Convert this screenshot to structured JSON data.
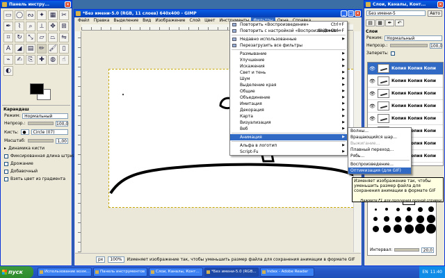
{
  "toolbox": {
    "title": "Панель инстру...",
    "tool_options_title": "Карандаш",
    "mode_label": "Режим:",
    "mode_value": "Нормальный",
    "opacity_label": "Непрозр.:",
    "opacity_value": "100,0",
    "brush_label": "Кисть:",
    "brush_value": "Circle (07)",
    "scale_label": "Масштаб:",
    "scale_value": "1,00",
    "dynamics_label": "Динамика кисти",
    "fade_label": "Фиксированная длина штриха",
    "jitter_label": "Дрожание",
    "incremental_label": "Добавочный",
    "gradient_label": "Взять цвет из градиента"
  },
  "image_window": {
    "title": "*Без имени-5.0 (RGB, 11 слоев) 640x400 - GIMP",
    "menu": [
      "Файл",
      "Правка",
      "Выделение",
      "Вид",
      "Изображение",
      "Слой",
      "Цвет",
      "Инструменты",
      "Фильтры",
      "Окна",
      "Справка"
    ],
    "status": {
      "unit": "px",
      "zoom": "100%",
      "message": "Изменяет изображение так, чтобы уменьшить размер файла для сохранения анимации в формате GIF"
    }
  },
  "filters_menu": {
    "items": [
      {
        "label": "Повторить «Воспроизведение»",
        "shortcut": "Ctrl+F"
      },
      {
        "label": "Повторить с настройкой «Воспроизведение»",
        "shortcut": "Shift+Ctrl+F"
      },
      {
        "label": "Недавно использованные",
        "shortcut": ""
      },
      {
        "label": "Перезагрузить все фильтры",
        "shortcut": ""
      },
      {
        "label": "Размывание",
        "shortcut": ""
      },
      {
        "label": "Улучшение",
        "shortcut": ""
      },
      {
        "label": "Искажения",
        "shortcut": ""
      },
      {
        "label": "Свет и тень",
        "shortcut": ""
      },
      {
        "label": "Шум",
        "shortcut": ""
      },
      {
        "label": "Выделение края",
        "shortcut": ""
      },
      {
        "label": "Общие",
        "shortcut": ""
      },
      {
        "label": "Объединение",
        "shortcut": ""
      },
      {
        "label": "Имитация",
        "shortcut": ""
      },
      {
        "label": "Декорация",
        "shortcut": ""
      },
      {
        "label": "Карта",
        "shortcut": ""
      },
      {
        "label": "Визуализация",
        "shortcut": ""
      },
      {
        "label": "Веб",
        "shortcut": ""
      },
      {
        "label": "Анимация",
        "shortcut": ""
      },
      {
        "label": "Альфа в логотип",
        "shortcut": ""
      },
      {
        "label": "Script-Fu",
        "shortcut": ""
      }
    ]
  },
  "animation_menu": {
    "items": [
      "Волны...",
      "Вращающийся шар...",
      "Выжигание...",
      "Плавный переход...",
      "Рябь...",
      "Воспроизведение...",
      "Оптимизация (для GIF)"
    ]
  },
  "tooltip": {
    "text": "Изменяет изображение так, чтобы уменьшить размер файла для сохранения анимации в формате GIF",
    "hint": "Нажмите F1 для получения полной справки"
  },
  "dock": {
    "title": "Слои, Каналы, Конт...",
    "image_select": "Без имени-5",
    "auto_label": "Авто",
    "layers_title": "Слои",
    "mode_label": "Режим:",
    "mode_value": "Нормальный",
    "opacity_label": "Непрозр.:",
    "opacity_value": "100,0",
    "lock_label": "Запереть:",
    "layer_name": "Копия Копия Копи",
    "brush_spacing_label": "Интервал:",
    "brush_spacing_value": "20,0"
  },
  "taskbar": {
    "start": "пуск",
    "tasks": [
      "Использование возм...",
      "Панель инструментов",
      "Слои, Каналы, Конт...",
      "*Без имени-5.0 (RGB...",
      "Index - Adobe Reader"
    ],
    "lang": "EN",
    "clock": "11:40"
  }
}
